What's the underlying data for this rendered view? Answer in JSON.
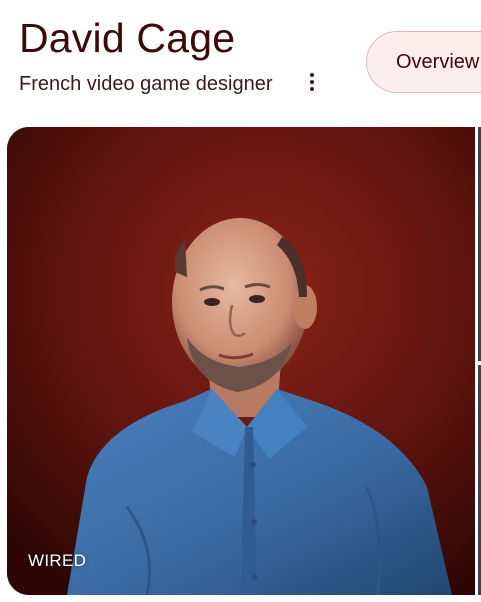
{
  "header": {
    "title": "David Cage",
    "subtitle": "French video game designer",
    "more_options_icon": "three-dots-vertical-icon"
  },
  "tabs": {
    "overview_label": "Overview"
  },
  "image": {
    "source_label": "WIRED",
    "background_color": "#5e1410",
    "shirt_color": "#3e6ea8"
  }
}
